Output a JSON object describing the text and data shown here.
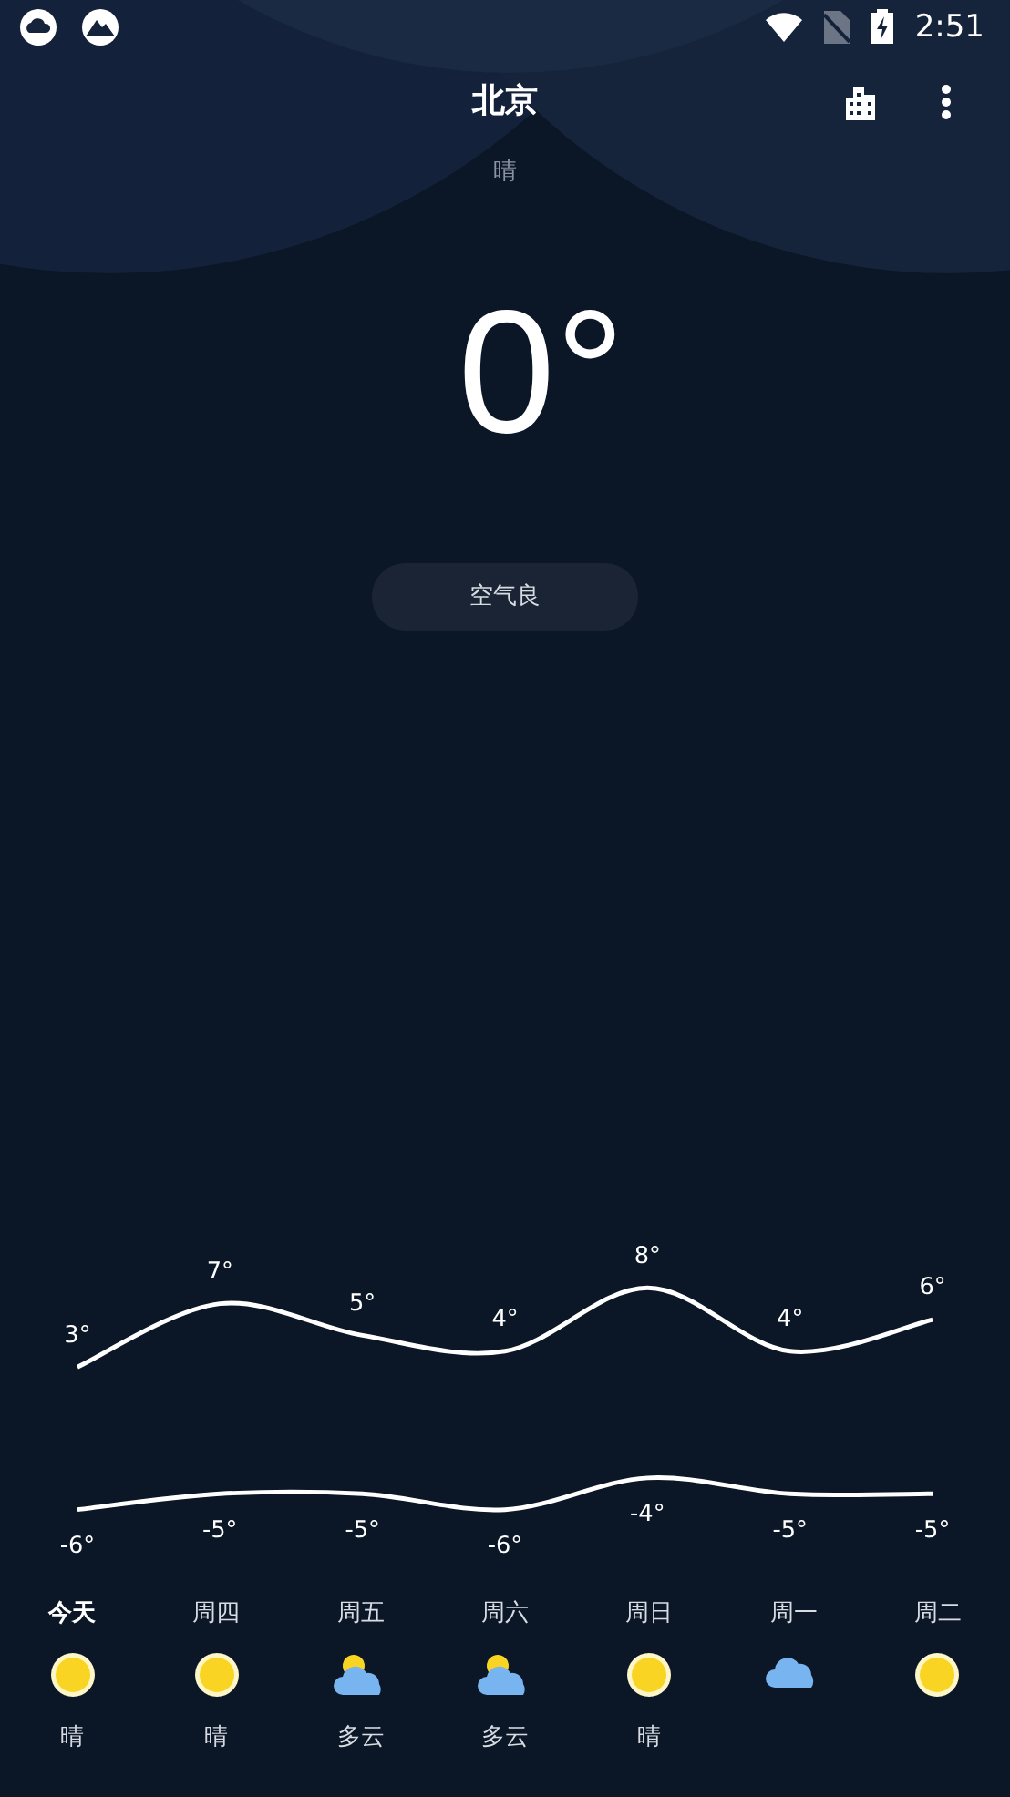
{
  "status_bar": {
    "time": "2:51"
  },
  "header": {
    "city": "北京",
    "condition": "晴"
  },
  "current": {
    "temperature": "0°",
    "air_quality": "空气良"
  },
  "trend": {
    "chart_data": {
      "type": "line",
      "data_labels": true,
      "categories": [
        null,
        null,
        null,
        null,
        null,
        null,
        null
      ],
      "series": [
        {
          "color": "#ffffff",
          "values": [
            3,
            7,
            5,
            4,
            8,
            4,
            6
          ],
          "value_labels": [
            "3°",
            "7°",
            "5°",
            "4°",
            "8°",
            "4°",
            "6°"
          ]
        },
        {
          "color": "#ffffff",
          "values": [
            -6,
            -5,
            -5,
            -6,
            -4,
            -5,
            -5
          ],
          "value_labels": [
            "-6°",
            "-5°",
            "-5°",
            "-6°",
            "-4°",
            "-5°",
            "-5°"
          ]
        }
      ]
    }
  },
  "forecast": [
    {
      "day": "今天",
      "current": true,
      "kind": "sunny",
      "condition": "晴"
    },
    {
      "day": "周四",
      "current": false,
      "kind": "sunny",
      "condition": "晴"
    },
    {
      "day": "周五",
      "current": false,
      "kind": "partly_cloudy",
      "condition": "多云"
    },
    {
      "day": "周六",
      "current": false,
      "kind": "partly_cloudy",
      "condition": "多云"
    },
    {
      "day": "周日",
      "current": false,
      "kind": "sunny",
      "condition": "晴"
    },
    {
      "day": "周一",
      "current": false,
      "kind": "cloudy"
    },
    {
      "day": "周二",
      "current": false,
      "kind": "sunny"
    }
  ]
}
